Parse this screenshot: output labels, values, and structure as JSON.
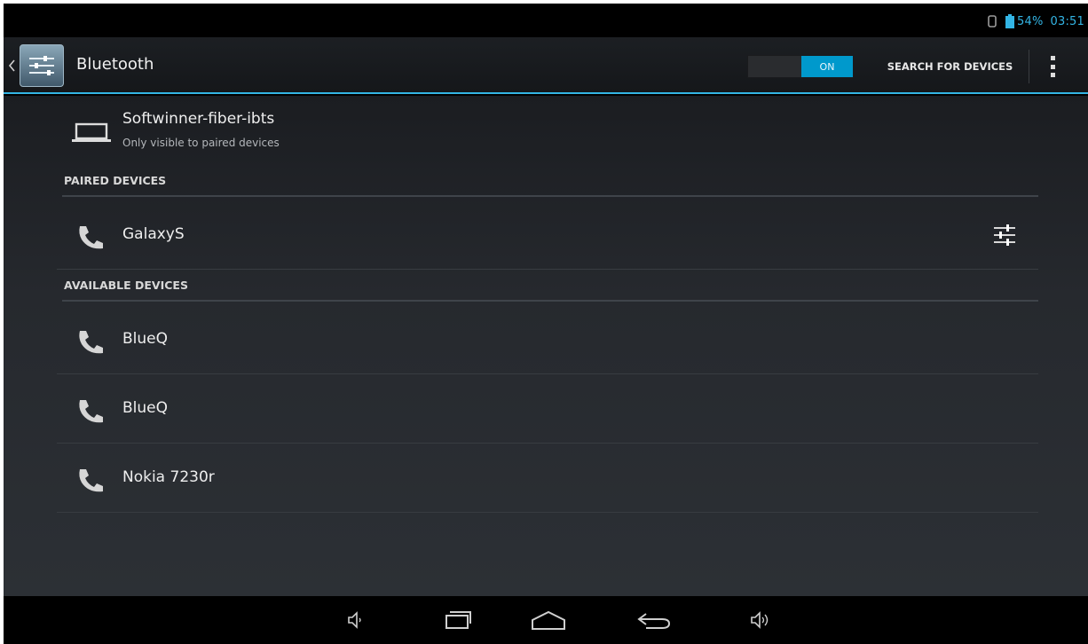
{
  "status_bar": {
    "battery_text": "54%",
    "time": "03:51",
    "accent": "#33b5e5"
  },
  "action_bar": {
    "title": "Bluetooth",
    "toggle_label": "ON",
    "search_label": "SEARCH FOR DEVICES",
    "icons": [
      "settings-app-icon",
      "up-caret-icon",
      "overflow-menu-icon"
    ]
  },
  "local_device": {
    "name": "Softwinner-fiber-ibts",
    "subtitle": "Only visible to paired devices",
    "icon": "laptop-icon"
  },
  "paired": {
    "header": "PAIRED DEVICES",
    "devices": [
      {
        "name": "GalaxyS",
        "icon": "phone-icon",
        "action_icon": "settings-sliders-icon"
      }
    ]
  },
  "available": {
    "header": "AVAILABLE DEVICES",
    "devices": [
      {
        "name": "BlueQ",
        "icon": "phone-icon"
      },
      {
        "name": "BlueQ",
        "icon": "phone-icon"
      },
      {
        "name": "Nokia 7230r",
        "icon": "phone-icon"
      }
    ]
  },
  "nav_bar": {
    "buttons": [
      "volume-down-icon",
      "recent-apps-icon",
      "home-icon",
      "back-icon",
      "volume-up-icon"
    ]
  }
}
